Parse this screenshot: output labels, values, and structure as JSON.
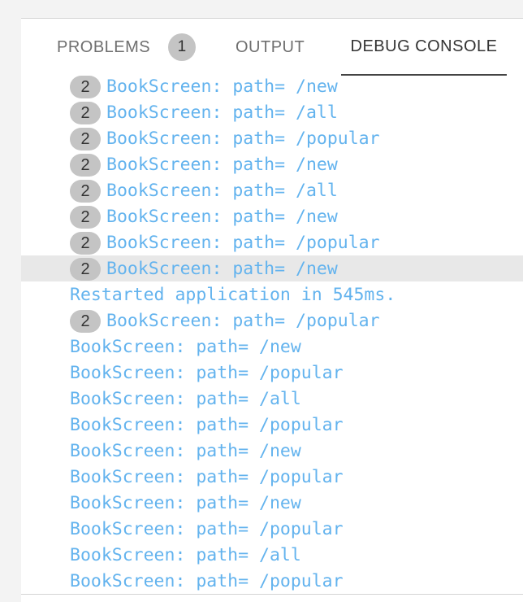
{
  "panel": {
    "tabs": [
      {
        "label": "PROBLEMS",
        "count": "1",
        "active": false
      },
      {
        "label": "OUTPUT",
        "active": false
      },
      {
        "label": "DEBUG CONSOLE",
        "active": true
      }
    ]
  },
  "console": {
    "lines": [
      {
        "text": "BookScreen: path= /new",
        "badge": "2"
      },
      {
        "text": "BookScreen: path= /all",
        "badge": "2"
      },
      {
        "text": "BookScreen: path= /popular",
        "badge": "2"
      },
      {
        "text": "BookScreen: path= /new",
        "badge": "2"
      },
      {
        "text": "BookScreen: path= /all",
        "badge": "2"
      },
      {
        "text": "BookScreen: path= /new",
        "badge": "2"
      },
      {
        "text": "BookScreen: path= /popular",
        "badge": "2"
      },
      {
        "text": "BookScreen: path= /new",
        "badge": "2",
        "highlighted": true
      },
      {
        "text": "Restarted application in 545ms."
      },
      {
        "text": "BookScreen: path= /popular",
        "badge": "2"
      },
      {
        "text": "BookScreen: path= /new"
      },
      {
        "text": "BookScreen: path= /popular"
      },
      {
        "text": "BookScreen: path= /all"
      },
      {
        "text": "BookScreen: path= /popular"
      },
      {
        "text": "BookScreen: path= /new"
      },
      {
        "text": "BookScreen: path= /popular"
      },
      {
        "text": "BookScreen: path= /new"
      },
      {
        "text": "BookScreen: path= /popular"
      },
      {
        "text": "BookScreen: path= /all"
      },
      {
        "text": "BookScreen: path= /popular"
      }
    ]
  },
  "colors": {
    "console_text": "#63b3ee",
    "badge_bg": "#c4c4c4",
    "highlight_bg": "#e8e8e8"
  }
}
